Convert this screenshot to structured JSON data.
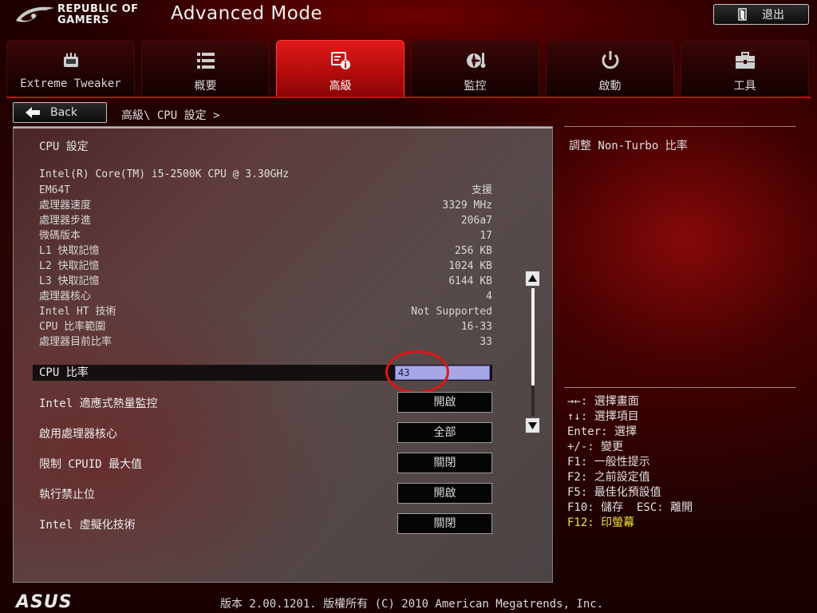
{
  "header": {
    "brand_line1": "REPUBLIC OF",
    "brand_line2": "GAMERS",
    "mode_title": "Advanced Mode",
    "exit_label": "退出"
  },
  "tabs": [
    {
      "label": "Extreme Tweaker",
      "icon": "tweaker-icon",
      "active": false
    },
    {
      "label": "概要",
      "icon": "summary-list-icon",
      "active": false
    },
    {
      "label": "高級",
      "icon": "advanced-info-icon",
      "active": true
    },
    {
      "label": "監控",
      "icon": "monitor-fan-icon",
      "active": false
    },
    {
      "label": "啟動",
      "icon": "power-icon",
      "active": false
    },
    {
      "label": "工具",
      "icon": "toolbox-icon",
      "active": false
    }
  ],
  "nav": {
    "back_label": "Back",
    "breadcrumb": "高級\\ CPU 設定 >"
  },
  "main": {
    "section_title": "CPU 設定",
    "cpu_model": "Intel(R) Core(TM) i5-2500K CPU @ 3.30GHz",
    "info_rows": [
      {
        "label": "EM64T",
        "value": "支援"
      },
      {
        "label": "處理器速度",
        "value": "3329 MHz"
      },
      {
        "label": "處理器步進",
        "value": "206a7"
      },
      {
        "label": "微碼版本",
        "value": "17"
      },
      {
        "label": "L1 快取記憶",
        "value": "256 KB"
      },
      {
        "label": "L2 快取記憶",
        "value": "1024 KB"
      },
      {
        "label": "L3 快取記憶",
        "value": "6144 KB"
      },
      {
        "label": "處理器核心",
        "value": "4"
      },
      {
        "label": "Intel HT 技術",
        "value": "Not Supported"
      },
      {
        "label": "CPU 比率範圍",
        "value": "16-33"
      },
      {
        "label": "處理器目前比率",
        "value": "33"
      }
    ],
    "cpu_ratio": {
      "label": "CPU 比率",
      "value": "43"
    },
    "settings": [
      {
        "label": "Intel 適應式熱量監控",
        "value": "開啟"
      },
      {
        "label": "啟用處理器核心",
        "value": "全部"
      },
      {
        "label": "限制 CPUID 最大值",
        "value": "關閉"
      },
      {
        "label": "執行禁止位",
        "value": "開啟"
      },
      {
        "label": "Intel 虛擬化技術",
        "value": "關閉"
      }
    ]
  },
  "help": {
    "description": "調整 Non-Turbo 比率"
  },
  "keys": [
    {
      "text": "→←: 選擇畫面",
      "highlight": false
    },
    {
      "text": "↑↓: 選擇項目",
      "highlight": false
    },
    {
      "text": "Enter: 選擇",
      "highlight": false
    },
    {
      "text": "+/-: 變更",
      "highlight": false
    },
    {
      "text": "F1: 一般性提示",
      "highlight": false
    },
    {
      "text": "F2: 之前設定值",
      "highlight": false
    },
    {
      "text": "F5: 最佳化預設值",
      "highlight": false
    },
    {
      "text": "F10: 儲存  ESC: 離開",
      "highlight": false
    },
    {
      "text": "F12: 印螢幕",
      "highlight": true
    }
  ],
  "footer": {
    "logo": "ASUS",
    "version_text": "版本 2.00.1201. 版權所有 (C) 2010 American Megatrends, Inc."
  },
  "colors": {
    "accent_red": "#c21010",
    "active_tab": "#d81515",
    "input_highlight": "#a7a7e8",
    "highlight_text": "#f5e23a",
    "annotation_ring": "#e01515"
  }
}
